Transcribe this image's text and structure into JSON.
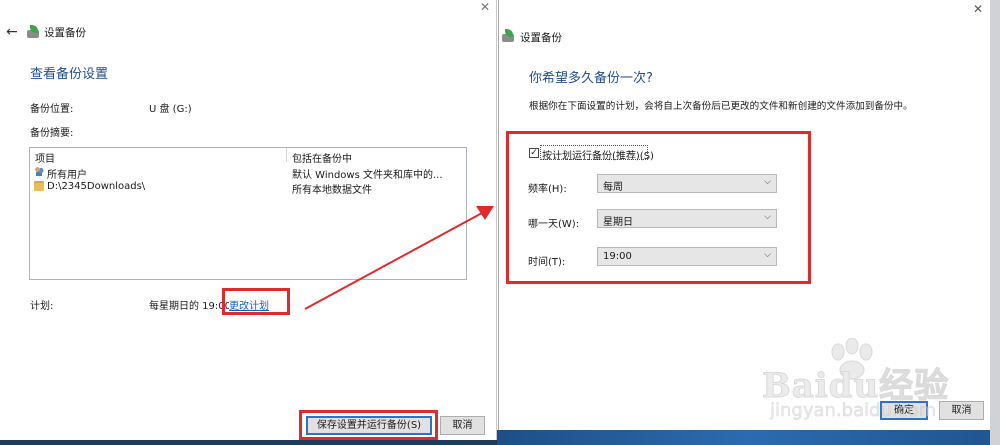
{
  "left_window": {
    "title": "设置备份",
    "heading": "查看备份设置",
    "location_label": "备份位置:",
    "location_value": "U 盘 (G:)",
    "summary_label": "备份摘要:",
    "list": {
      "col_item": "项目",
      "col_included": "包括在备份中",
      "rows": [
        {
          "icon": "users-icon",
          "name": "所有用户",
          "included": "默认 Windows 文件夹和库中的..."
        },
        {
          "icon": "folder-icon",
          "name": "D:\\2345Downloads\\",
          "included": "所有本地数据文件"
        }
      ]
    },
    "schedule_label": "计划:",
    "schedule_value": "每星期日的 19:00",
    "change_schedule_link": "更改计划",
    "save_button": "保存设置并运行备份(S)",
    "cancel_button": "取消"
  },
  "right_window": {
    "title": "设置备份",
    "heading": "你希望多久备份一次?",
    "description": "根据你在下面设置的计划，会将自上次备份后已更改的文件和新创建的文件添加到备份中。",
    "checkbox_label": "按计划运行备份(推荐)(S)",
    "checkbox_checked": true,
    "frequency_label": "频率(H):",
    "frequency_value": "每周",
    "day_label": "哪一天(W):",
    "day_value": "星期日",
    "time_label": "时间(T):",
    "time_value": "19:00",
    "ok_button": "确定",
    "cancel_button": "取消"
  },
  "watermark": {
    "logo_text": "Baidu经验",
    "url": "jingyan.baidu.com"
  },
  "colors": {
    "heading_blue": "#1f4f91",
    "link_blue": "#0b64c0",
    "annotation_red": "#e22a2a",
    "button_focus": "#2a73c8"
  }
}
